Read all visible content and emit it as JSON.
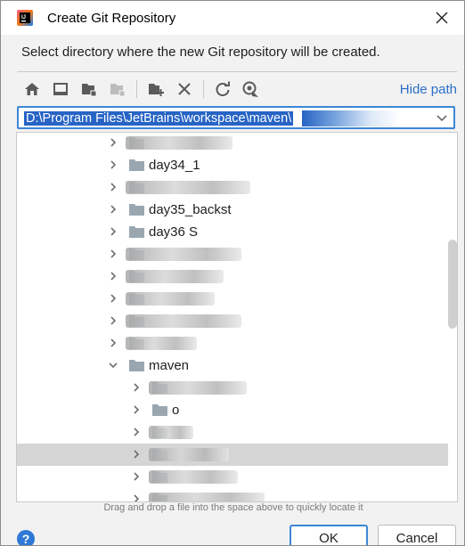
{
  "window": {
    "title": "Create Git Repository"
  },
  "description": "Select directory where the new Git repository will be created.",
  "toolbar": {
    "buttons": [
      {
        "icon": "home-icon"
      },
      {
        "icon": "desktop-icon"
      },
      {
        "icon": "project-folder-icon"
      },
      {
        "icon": "module-folder-icon"
      },
      {
        "icon": "new-folder-icon"
      },
      {
        "icon": "delete-icon"
      },
      {
        "icon": "refresh-icon"
      },
      {
        "icon": "show-hidden-icon"
      }
    ],
    "hide_path": "Hide path"
  },
  "path": {
    "value": "D:\\Program Files\\JetBrains\\workspace\\maven\\"
  },
  "tree": {
    "items": [
      {
        "label": "",
        "state": "collapsed",
        "level": 1
      },
      {
        "label": "day34_1",
        "state": "collapsed",
        "level": 1
      },
      {
        "label": "",
        "state": "collapsed",
        "level": 1
      },
      {
        "label": "day35_backst",
        "state": "collapsed",
        "level": 1
      },
      {
        "label": "day36 S",
        "state": "collapsed",
        "level": 1
      },
      {
        "label": "",
        "state": "collapsed",
        "level": 1
      },
      {
        "label": "",
        "state": "collapsed",
        "level": 1
      },
      {
        "label": "",
        "state": "collapsed",
        "level": 1
      },
      {
        "label": "",
        "state": "collapsed",
        "level": 1
      },
      {
        "label": "",
        "state": "collapsed",
        "level": 1
      },
      {
        "label": "maven",
        "state": "expanded",
        "level": 1
      },
      {
        "label": "",
        "state": "collapsed",
        "level": 2
      },
      {
        "label": "o",
        "state": "collapsed",
        "level": 2
      },
      {
        "label": "",
        "state": "collapsed",
        "level": 2
      },
      {
        "label": "",
        "state": "collapsed",
        "level": 2,
        "selected": true
      },
      {
        "label": "",
        "state": "collapsed",
        "level": 2
      },
      {
        "label": "",
        "state": "collapsed",
        "level": 2
      }
    ]
  },
  "hint": "Drag and drop a file into the space above to quickly locate it",
  "buttons": {
    "ok": "OK",
    "cancel": "Cancel",
    "help": "?"
  },
  "colors": {
    "accent": "#3d86d6",
    "link": "#2a6fc9",
    "selection": "#2764c5"
  }
}
